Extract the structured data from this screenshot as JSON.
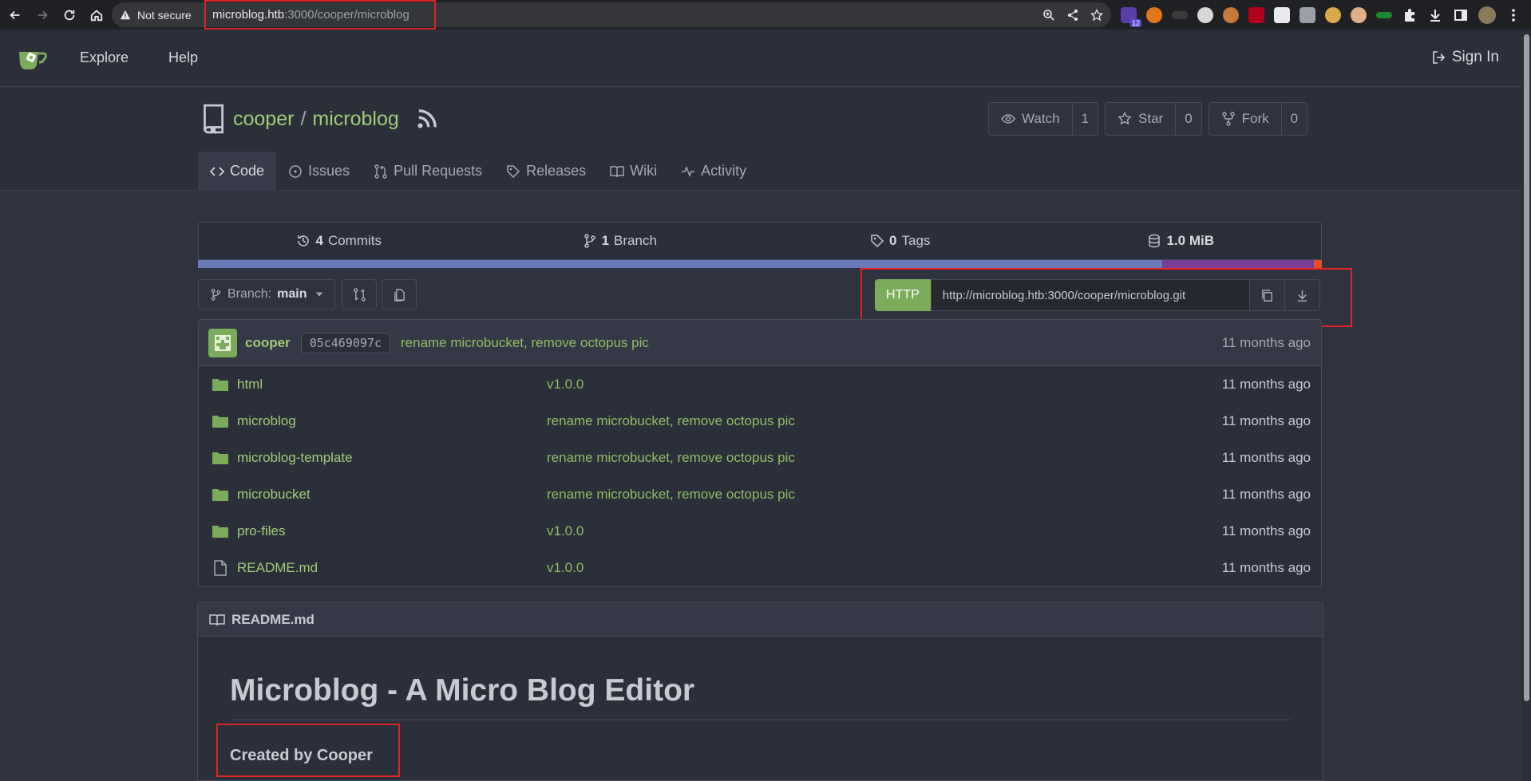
{
  "browser": {
    "security": "Not secure",
    "url_host": "microblog.htb",
    "url_path": ":3000/cooper/microblog",
    "ext_badge": "12"
  },
  "nav": {
    "explore": "Explore",
    "help": "Help",
    "signin": "Sign In"
  },
  "repo": {
    "owner": "cooper",
    "slash": "/",
    "name": "microblog",
    "watch_label": "Watch",
    "watch_count": "1",
    "star_label": "Star",
    "star_count": "0",
    "fork_label": "Fork",
    "fork_count": "0"
  },
  "tabs": [
    {
      "label": "Code",
      "icon": "code-icon"
    },
    {
      "label": "Issues",
      "icon": "issue-icon"
    },
    {
      "label": "Pull Requests",
      "icon": "pull-request-icon"
    },
    {
      "label": "Releases",
      "icon": "tag-icon"
    },
    {
      "label": "Wiki",
      "icon": "book-icon"
    },
    {
      "label": "Activity",
      "icon": "pulse-icon"
    }
  ],
  "stats": {
    "commits_count": "4",
    "commits_label": "Commits",
    "branch_count": "1",
    "branch_label": "Branch",
    "tags_count": "0",
    "tags_label": "Tags",
    "size": "1.0 MiB"
  },
  "branch": {
    "prefix": "Branch:",
    "name": "main"
  },
  "clone": {
    "protocol": "HTTP",
    "url": "http://microblog.htb:3000/cooper/microblog.git"
  },
  "last_commit": {
    "author": "cooper",
    "sha": "05c469097c",
    "message": "rename microbucket, remove octopus pic",
    "time": "11 months ago"
  },
  "files": [
    {
      "name": "html",
      "type": "folder",
      "message": "v1.0.0",
      "time": "11 months ago"
    },
    {
      "name": "microblog",
      "type": "folder",
      "message": "rename microbucket, remove octopus pic",
      "time": "11 months ago"
    },
    {
      "name": "microblog-template",
      "type": "folder",
      "message": "rename microbucket, remove octopus pic",
      "time": "11 months ago"
    },
    {
      "name": "microbucket",
      "type": "folder",
      "message": "rename microbucket, remove octopus pic",
      "time": "11 months ago"
    },
    {
      "name": "pro-files",
      "type": "folder",
      "message": "v1.0.0",
      "time": "11 months ago"
    },
    {
      "name": "README.md",
      "type": "file",
      "message": "v1.0.0",
      "time": "11 months ago"
    }
  ],
  "readme": {
    "filename": "README.md",
    "heading": "Microblog - A Micro Blog Editor",
    "byline": "Created by Cooper"
  },
  "colors": {
    "accent_green": "#9fcc76",
    "highlight_red": "#e02424",
    "background": "#2f3340"
  }
}
